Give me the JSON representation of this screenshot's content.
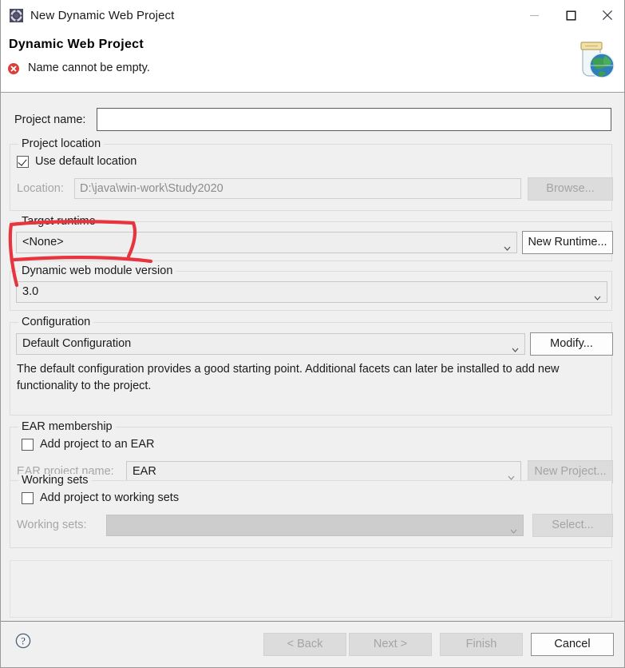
{
  "window": {
    "title": "New Dynamic Web Project",
    "icon": "eclipse-wizard-icon",
    "controls": {
      "minimize": "minimize-icon",
      "maximize": "maximize-icon",
      "close": "close-icon"
    }
  },
  "header": {
    "title": "Dynamic Web Project",
    "message": "Name cannot be empty.",
    "message_icon": "error-circle-icon",
    "banner_icon": "web-project-jar-globe-icon",
    "error_color": "#d9403a"
  },
  "project_name": {
    "label": "Project name:",
    "value": "",
    "placeholder": ""
  },
  "project_location": {
    "group_title": "Project location",
    "use_default": {
      "label": "Use default location",
      "checked": true
    },
    "location": {
      "label": "Location:",
      "value": "D:\\java\\win-work\\Study2020",
      "enabled": false
    },
    "browse_button": {
      "label": "Browse...",
      "enabled": false
    }
  },
  "target_runtime": {
    "group_title": "Target runtime",
    "selected": "<None>",
    "options": [
      "<None>"
    ],
    "new_runtime_button": {
      "label": "New Runtime...",
      "enabled": true
    }
  },
  "web_module_version": {
    "group_title": "Dynamic web module version",
    "selected": "3.0",
    "options": [
      "3.0"
    ]
  },
  "configuration": {
    "group_title": "Configuration",
    "selected": "Default Configuration",
    "options": [
      "Default Configuration"
    ],
    "modify_button": {
      "label": "Modify...",
      "enabled": true
    },
    "description": "The default configuration provides a good starting point. Additional facets can later be installed to add new functionality to the project."
  },
  "ear_membership": {
    "group_title": "EAR membership",
    "add_to_ear": {
      "label": "Add project to an EAR",
      "checked": false
    },
    "ear_project_name": {
      "label": "EAR project name:",
      "value": "EAR",
      "enabled": false
    },
    "new_project_button": {
      "label": "New Project...",
      "enabled": false
    }
  },
  "working_sets": {
    "group_title": "Working sets",
    "add_to_working_sets": {
      "label": "Add project to working sets",
      "checked": false
    },
    "working_sets_field": {
      "label": "Working sets:",
      "value": "",
      "enabled": false
    },
    "select_button": {
      "label": "Select...",
      "enabled": false
    }
  },
  "footer": {
    "help_icon": "help-question-icon",
    "buttons": [
      {
        "label": "< Back",
        "enabled": false
      },
      {
        "label": "Next >",
        "enabled": false
      },
      {
        "label": "Finish",
        "enabled": false
      },
      {
        "label": "Cancel",
        "enabled": true
      }
    ]
  },
  "annotation": {
    "type": "hand-drawn-rectangle-with-tail",
    "color": "#e8343e",
    "target": "target-runtime-combo"
  }
}
